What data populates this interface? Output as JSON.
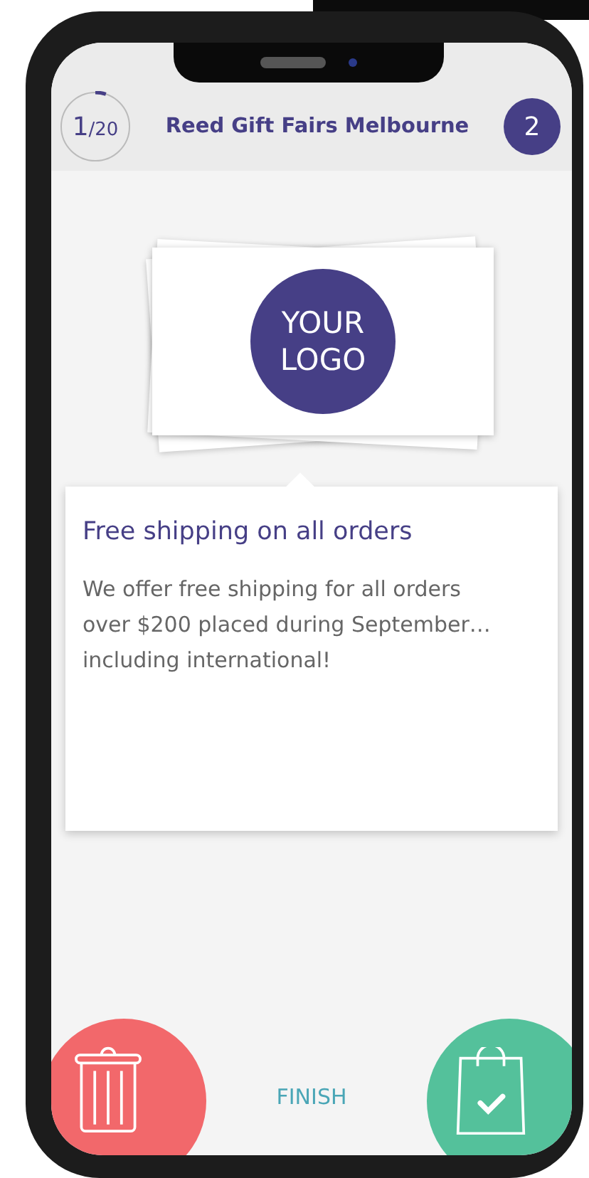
{
  "header": {
    "progress": {
      "current": "1",
      "total": "/20",
      "level": 0.05
    },
    "title": "Reed Gift Fairs Melbourne",
    "badge": "2"
  },
  "offer": {
    "logo_lines": [
      "YOUR",
      "LOGO"
    ],
    "title": "Free shipping on all orders",
    "text": "We offer free shipping for all orders over $200 placed during September… including international!"
  },
  "footer": {
    "finish": "FINISH"
  }
}
